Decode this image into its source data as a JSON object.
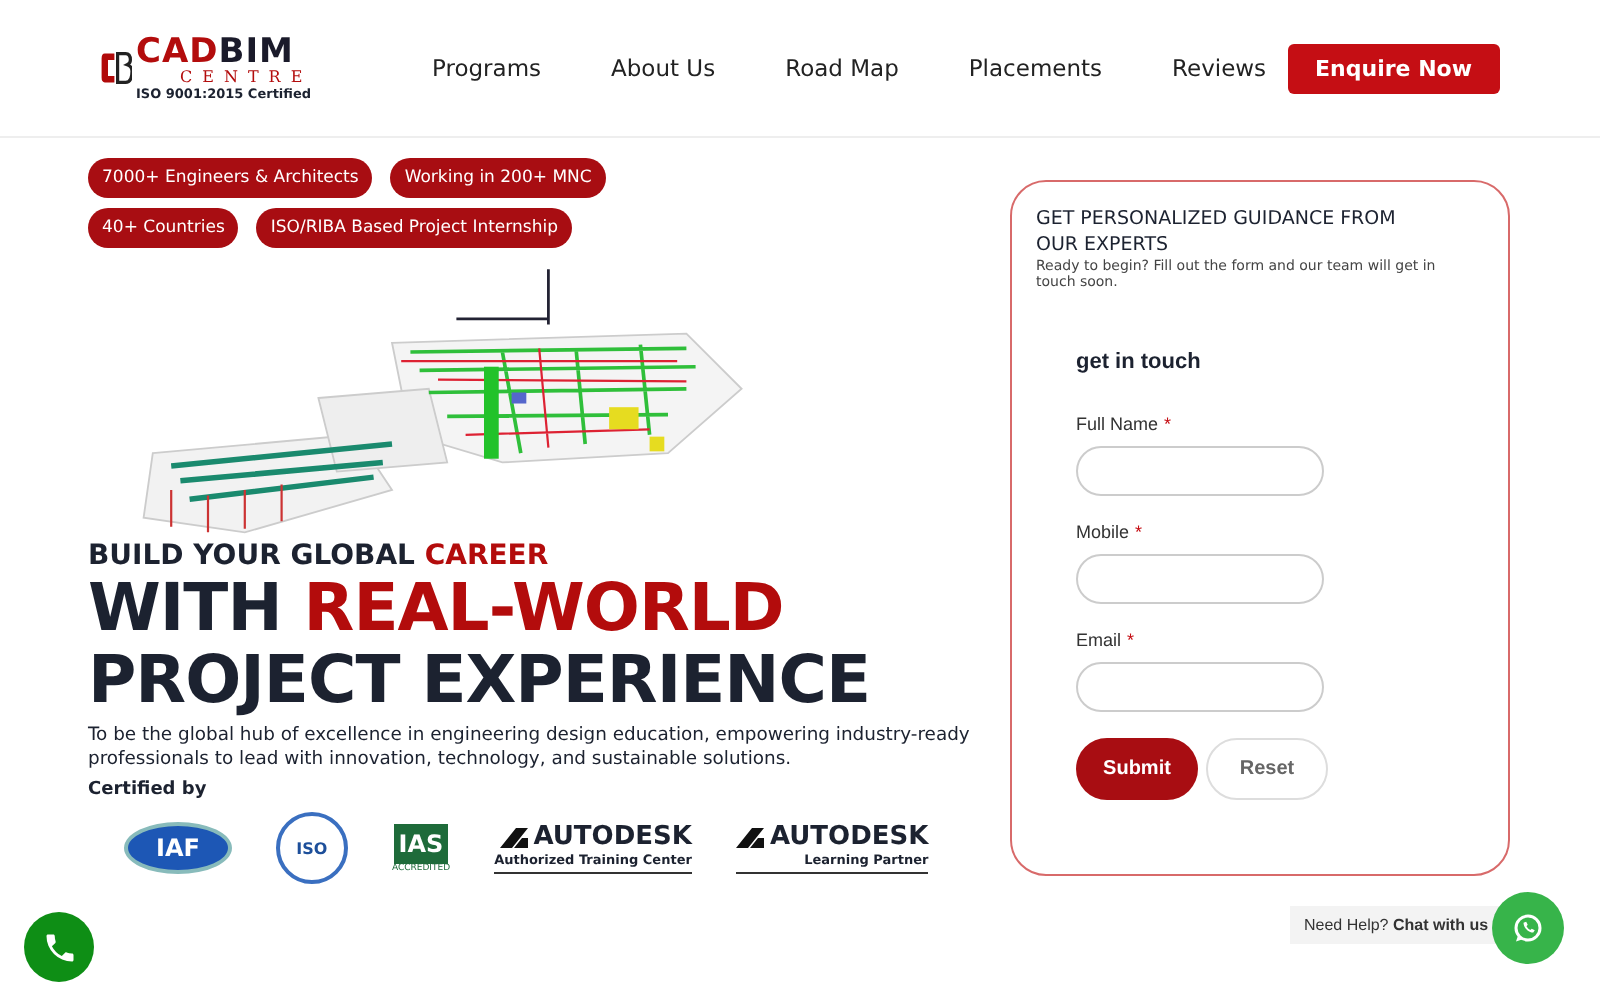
{
  "logo": {
    "name_1": "CAD",
    "name_2": "BIM",
    "sub": "CENTRE",
    "tagline": "ISO 9001:2015 Certified"
  },
  "nav": [
    {
      "label": "Programs"
    },
    {
      "label": "About Us"
    },
    {
      "label": "Road Map"
    },
    {
      "label": "Placements"
    },
    {
      "label": "Reviews"
    }
  ],
  "enquire_button": "Enquire Now",
  "badges": [
    "7000+ Engineers & Architects",
    "Working in 200+ MNC",
    "40+ Countries",
    "ISO/RIBA Based Project Internship"
  ],
  "tagline": [
    {
      "text": "BUILD YOUR GLOBAL ",
      "accent": false
    },
    {
      "text": "CAREER",
      "accent": true
    }
  ],
  "headline_lines": [
    [
      {
        "text": "WITH ",
        "accent": false
      },
      {
        "text": "REAL-WORLD",
        "accent": true
      }
    ],
    [
      {
        "text": "PROJECT EXPERIENCE",
        "accent": false
      }
    ]
  ],
  "description": "To be the global hub of excellence in engineering design education, empowering industry-ready professionals to lead with innovation, technology, and sustainable solutions.",
  "certified_label": "Certified by",
  "certifications": [
    {
      "kind": "iaf",
      "label": "IAF"
    },
    {
      "kind": "iso",
      "label": "ISO"
    },
    {
      "kind": "ias",
      "label": "IAS",
      "caption": "ACCREDITED"
    },
    {
      "kind": "autodesk",
      "label": "AUTODESK",
      "caption": "Authorized Training Center"
    },
    {
      "kind": "autodesk",
      "label": "AUTODESK",
      "caption": "Learning Partner"
    }
  ],
  "form": {
    "title": "GET PERSONALIZED GUIDANCE FROM OUR EXPERTS",
    "intro": "Ready to begin? Fill out the form and our team will get in touch soon.",
    "heading": "get in touch",
    "fields": [
      {
        "label": "Full Name",
        "required": true
      },
      {
        "label": "Mobile",
        "required": true
      },
      {
        "label": "Email",
        "required": true
      }
    ],
    "required_mark": "*",
    "submit": "Submit",
    "reset": "Reset"
  },
  "chat": {
    "text": "Need Help? **Chat with us**"
  }
}
